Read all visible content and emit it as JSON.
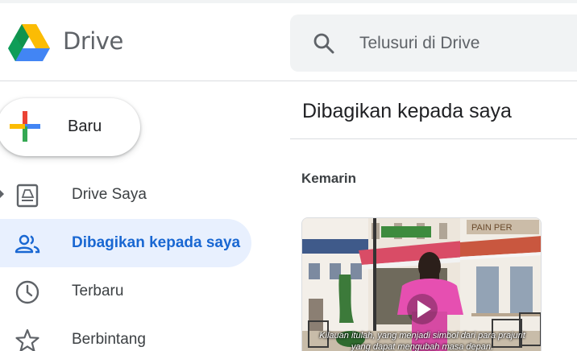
{
  "header": {
    "app_name": "Drive",
    "search_placeholder": "Telusuri di Drive"
  },
  "new_button": {
    "label": "Baru"
  },
  "sidebar": {
    "items": [
      {
        "label": "Drive Saya",
        "icon": "drive-folder-icon",
        "active": false
      },
      {
        "label": "Dibagikan kepada saya",
        "icon": "shared-people-icon",
        "active": true
      },
      {
        "label": "Terbaru",
        "icon": "clock-icon",
        "active": false
      },
      {
        "label": "Berbintang",
        "icon": "star-icon",
        "active": false
      }
    ]
  },
  "main": {
    "title": "Dibagikan kepada saya",
    "section": "Kemarin",
    "files": [
      {
        "type": "video",
        "sign_text": "PAIN PER",
        "subtitle_line1": "Kilauan itulah, yang menjadi simbol dari para prajurit",
        "subtitle_line2": "yang dapat mengubah masa depan."
      }
    ]
  },
  "colors": {
    "accent": "#1967d2",
    "active_bg": "#e8f0fe",
    "search_bg": "#f1f3f4",
    "google_blue": "#4285f4",
    "google_red": "#ea4335",
    "google_yellow": "#fbbc04",
    "google_green": "#34a853"
  }
}
